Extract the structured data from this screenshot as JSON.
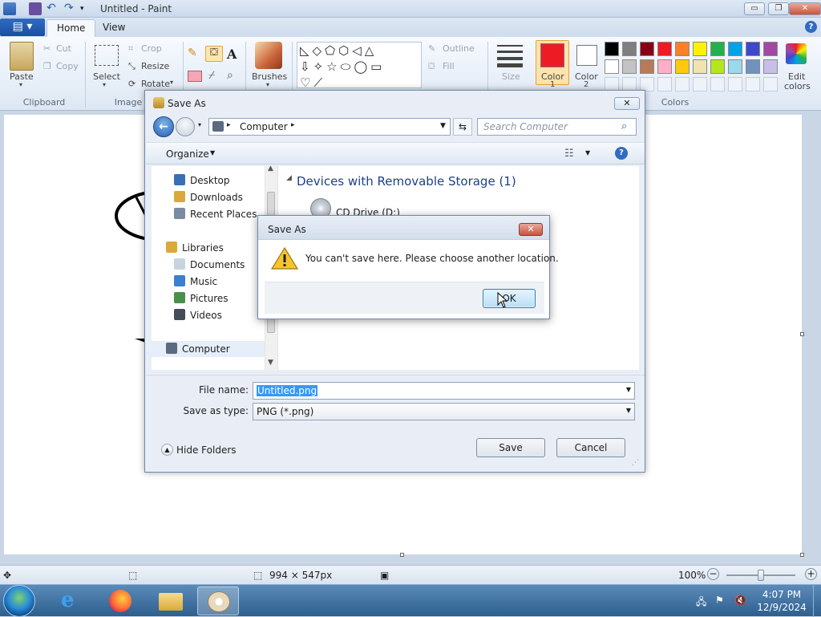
{
  "app": {
    "title": "Untitled - Paint",
    "window_controls": {
      "minimize": "▭",
      "restore": "❐",
      "close": "✕"
    }
  },
  "ribbon": {
    "tabs": [
      {
        "label": "Home",
        "active": true
      },
      {
        "label": "View",
        "active": false
      }
    ],
    "clipboard": {
      "paste": "Paste",
      "cut": "Cut",
      "copy": "Copy",
      "group": "Clipboard"
    },
    "image": {
      "select": "Select",
      "crop": "Crop",
      "resize": "Resize",
      "rotate": "Rotate",
      "group": "Image"
    },
    "tools": {
      "brushes": "Brushes"
    },
    "shapes": {
      "outline": "Outline",
      "fill": "Fill"
    },
    "size": "Size",
    "color1": {
      "label": "Color",
      "num": "1",
      "color": "#ed1c24"
    },
    "color2": {
      "label": "Color",
      "num": "2",
      "color": "#ffffff"
    },
    "colors_group": "Colors",
    "edit_colors": {
      "line1": "Edit",
      "line2": "colors"
    },
    "palette_row1": [
      "#000000",
      "#7f7f7f",
      "#880015",
      "#ed1c24",
      "#ff7f27",
      "#fff200",
      "#22b14c",
      "#00a2e8",
      "#3f48cc",
      "#a349a4"
    ],
    "palette_row2": [
      "#ffffff",
      "#c3c3c3",
      "#b97a57",
      "#ffaec9",
      "#ffc90e",
      "#efe4b0",
      "#b5e61d",
      "#99d9ea",
      "#7092be",
      "#c8bfe7"
    ]
  },
  "statusbar": {
    "dimensions": "994 × 547px",
    "zoom": "100%"
  },
  "taskbar": {
    "time": "4:07 PM",
    "date": "12/9/2024"
  },
  "saveas": {
    "title": "Save As",
    "address": "Computer",
    "search_placeholder": "Search Computer",
    "organize": "Organize",
    "nav": [
      {
        "label": "Desktop",
        "icon": "desktop-icon",
        "color": "#3a6fb5"
      },
      {
        "label": "Downloads",
        "icon": "downloads-icon",
        "color": "#d9a93a"
      },
      {
        "label": "Recent Places",
        "icon": "recent-places-icon",
        "color": "#7a8aa0"
      },
      {
        "label": "Libraries",
        "icon": "libraries-icon",
        "color": "#d9a93a"
      },
      {
        "label": "Documents",
        "icon": "documents-icon",
        "color": "#c9d3df"
      },
      {
        "label": "Music",
        "icon": "music-icon",
        "color": "#3a7fd0"
      },
      {
        "label": "Pictures",
        "icon": "pictures-icon",
        "color": "#4a8f4a"
      },
      {
        "label": "Videos",
        "icon": "videos-icon",
        "color": "#444c58"
      },
      {
        "label": "Computer",
        "icon": "computer-icon",
        "color": "#5a6a80"
      }
    ],
    "group_header": "Devices with Removable Storage (1)",
    "drive_label": "CD Drive (D:)",
    "file_name_label": "File name:",
    "file_name_value": "Untitled.png",
    "save_type_label": "Save as type:",
    "save_type_value": "PNG (*.png)",
    "hide_folders": "Hide Folders",
    "save_button": "Save",
    "cancel_button": "Cancel"
  },
  "error_dialog": {
    "title": "Save As",
    "message": "You can't save here. Please choose another location.",
    "ok_button": "OK"
  }
}
